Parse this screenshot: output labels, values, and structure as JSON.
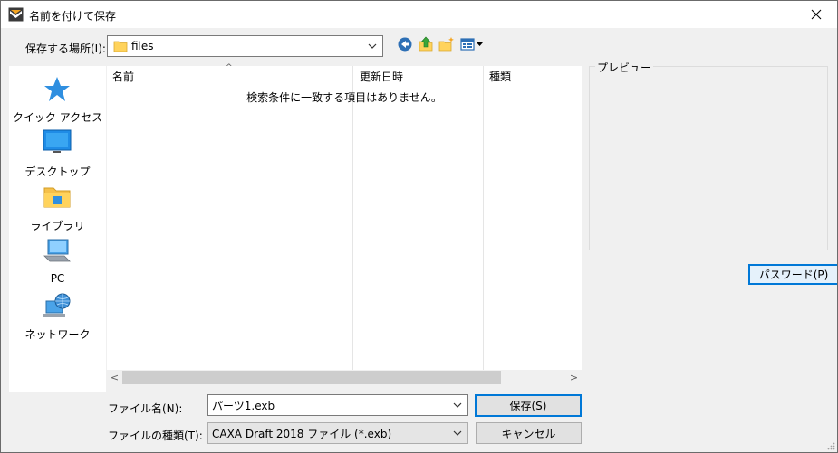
{
  "window": {
    "title": "名前を付けて保存",
    "close_glyph": "✕"
  },
  "location": {
    "label": "保存する場所(I):",
    "value": "files"
  },
  "toolbar_icons": [
    "back-icon",
    "up-folder-icon",
    "new-folder-icon",
    "view-menu-icon"
  ],
  "places": [
    {
      "label": "クイック アクセス",
      "icon": "star-icon"
    },
    {
      "label": "デスクトップ",
      "icon": "desktop-icon"
    },
    {
      "label": "ライブラリ",
      "icon": "library-folder-icon"
    },
    {
      "label": "PC",
      "icon": "pc-icon"
    },
    {
      "label": "ネットワーク",
      "icon": "network-icon"
    }
  ],
  "file_list": {
    "columns": [
      "名前",
      "更新日時",
      "種類"
    ],
    "sort_glyph": "^",
    "empty_message": "検索条件に一致する項目はありません。"
  },
  "scroll": {
    "left_glyph": "<",
    "right_glyph": ">"
  },
  "preview": {
    "label": "プレビュー"
  },
  "password_button": "パスワード(P)",
  "filename": {
    "label": "ファイル名(N):",
    "value": "パーツ1.exb"
  },
  "filetype": {
    "label": "ファイルの種類(T):",
    "value": "CAXA Draft 2018 ファイル (*.exb)"
  },
  "buttons": {
    "save": "保存(S)",
    "cancel": "キャンセル"
  },
  "colors": {
    "accent": "#0078d7",
    "dialog_bg": "#f0f0f0",
    "folder": "#ffd35c"
  }
}
